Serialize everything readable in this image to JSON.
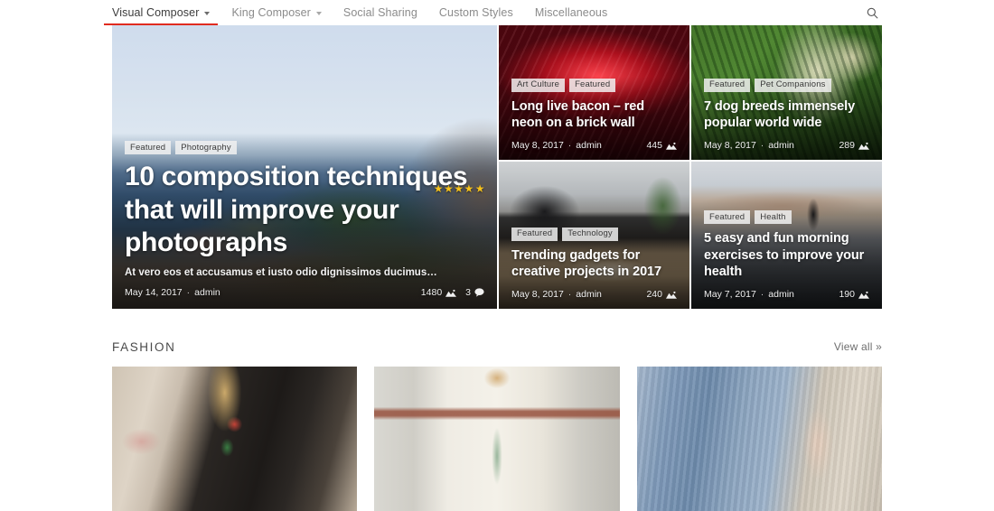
{
  "nav": {
    "items": [
      {
        "label": "Visual Composer",
        "has_dropdown": true,
        "active": true
      },
      {
        "label": "King Composer",
        "has_dropdown": true,
        "active": false
      },
      {
        "label": "Social Sharing",
        "has_dropdown": false,
        "active": false
      },
      {
        "label": "Custom Styles",
        "has_dropdown": false,
        "active": false
      },
      {
        "label": "Miscellaneous",
        "has_dropdown": false,
        "active": false
      }
    ],
    "search_icon": "search-icon",
    "accent_color": "#e02b20"
  },
  "hero": {
    "tags": [
      "Featured",
      "Photography"
    ],
    "title": "10 composition techniques that will improve your photographs",
    "excerpt": "At vero eos et accusamus et iusto odio dignissimos ducimus…",
    "date": "May 14, 2017",
    "separator": "·",
    "author": "admin",
    "views": "1480",
    "comments": "3",
    "rating": "★★★★",
    "rating_half": "★",
    "rating_value": 4.5
  },
  "cards": [
    {
      "tags": [
        "Art Culture",
        "Featured"
      ],
      "title": "Long live bacon – red neon on a brick wall",
      "date": "May 8, 2017",
      "separator": "·",
      "author": "admin",
      "views": "445",
      "bg": "bg-neon"
    },
    {
      "tags": [
        "Featured",
        "Pet Companions"
      ],
      "title": "7 dog breeds immensely popular world wide",
      "date": "May 8, 2017",
      "separator": "·",
      "author": "admin",
      "views": "289",
      "bg": "bg-dog"
    },
    {
      "tags": [
        "Featured",
        "Technology"
      ],
      "title": "Trending gadgets for creative projects in 2017",
      "date": "May 8, 2017",
      "separator": "·",
      "author": "admin",
      "views": "240",
      "bg": "bg-desk"
    },
    {
      "tags": [
        "Featured",
        "Health"
      ],
      "title": "5 easy and fun morning exercises to improve your health",
      "date": "May 7, 2017",
      "separator": "·",
      "author": "admin",
      "views": "190",
      "bg": "bg-road"
    }
  ],
  "section": {
    "title": "FASHION",
    "view_all": "View all »"
  },
  "fashion": [
    {
      "alt": "woman in embroidered leather jacket holding coffee",
      "bg": "bg-jacket"
    },
    {
      "alt": "woman in white belted coat over floral dress",
      "bg": "bg-coat"
    },
    {
      "alt": "woman in high waisted blue jeans",
      "bg": "bg-jeans"
    }
  ]
}
